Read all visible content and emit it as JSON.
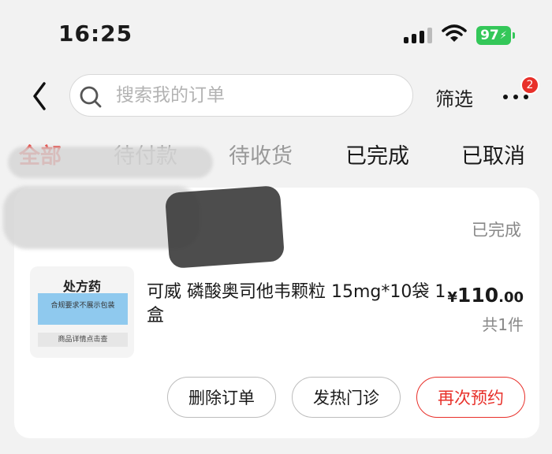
{
  "status_bar": {
    "time": "16:25",
    "battery": "97"
  },
  "search": {
    "placeholder": "搜索我的订单"
  },
  "header": {
    "filter_label": "筛选",
    "more_badge": "2"
  },
  "tabs": [
    {
      "label": "全部"
    },
    {
      "label": "待付款"
    },
    {
      "label": "待收货"
    },
    {
      "label": "已完成"
    },
    {
      "label": "已取消"
    }
  ],
  "order": {
    "status": "已完成",
    "thumbnail": {
      "title": "处方药",
      "note": "合规要求不展示包装",
      "footer": "商品详情点击查"
    },
    "product_name": "可威 磷酸奥司他韦颗粒 15mg*10袋 1盒",
    "price_currency": "¥",
    "price_int": "110",
    "price_dec": ".00",
    "quantity": "共1件",
    "buttons": {
      "delete": "删除订单",
      "fever_clinic": "发热门诊",
      "rebook": "再次预约"
    }
  },
  "colors": {
    "accent": "#e8302a",
    "battery": "#34c759",
    "background": "#f2f2f2"
  }
}
